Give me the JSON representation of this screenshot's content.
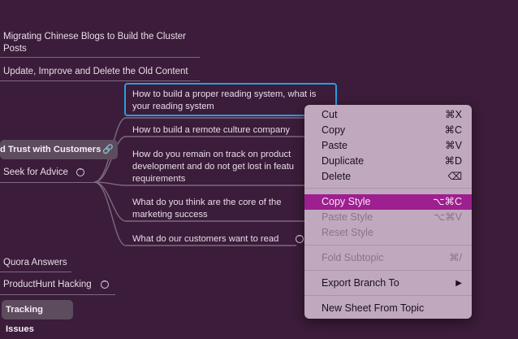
{
  "canvas": {
    "left_topics": [
      "Migrating Chinese Blogs to Build the Cluster Posts",
      "Update, Improve and Delete the Old Content"
    ],
    "central_topic": "d Trust with Customers",
    "seek_topic": "Seek for Advice",
    "subtopics": [
      "How to build a proper reading system, what is your reading system",
      "How to build a remote culture company",
      "How do you remain on track on product development and do not get lost in featu requirements",
      "What do you think are the core of the marketing success",
      "What do our customers want to read"
    ],
    "lower_topics": [
      "Quora Answers",
      "ProductHunt Hacking"
    ],
    "tracking_label": "Tracking Issues"
  },
  "context_menu": {
    "items": [
      {
        "label": "Cut",
        "shortcut": "⌘X",
        "enabled": true
      },
      {
        "label": "Copy",
        "shortcut": "⌘C",
        "enabled": true
      },
      {
        "label": "Paste",
        "shortcut": "⌘V",
        "enabled": true
      },
      {
        "label": "Duplicate",
        "shortcut": "⌘D",
        "enabled": true
      },
      {
        "label": "Delete",
        "shortcut": "⌫",
        "enabled": true
      },
      {
        "label": "Copy Style",
        "shortcut": "⌥⌘C",
        "enabled": true,
        "highlighted": true
      },
      {
        "label": "Paste Style",
        "shortcut": "⌥⌘V",
        "enabled": false
      },
      {
        "label": "Reset Style",
        "shortcut": "",
        "enabled": false
      },
      {
        "label": "Fold Subtopic",
        "shortcut": "⌘/",
        "enabled": false
      },
      {
        "label": "Export Branch To",
        "shortcut": "",
        "enabled": true,
        "has_submenu": true
      },
      {
        "label": "New Sheet From Topic",
        "shortcut": "",
        "enabled": true
      }
    ]
  },
  "colors": {
    "background": "#3b1c3a",
    "menu_background": "#c0a9bf",
    "menu_highlight": "#9e1f8f",
    "selection_border": "#2d9cdb"
  }
}
